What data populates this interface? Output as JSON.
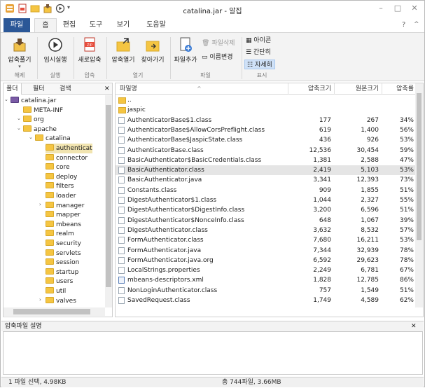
{
  "window": {
    "title": "catalina.jar - 알집",
    "controls": [
      "–",
      "□",
      "✕"
    ]
  },
  "quick_access": {
    "dropdown": "▾"
  },
  "tabs": {
    "file": "파일",
    "items": [
      "홈",
      "편집",
      "도구",
      "보기",
      "도움말"
    ],
    "help_icon": "?",
    "collapse_icon": "^"
  },
  "ribbon": {
    "extract_label": "압축풀기",
    "run_label": "임시실행",
    "new_label": "새로압축",
    "open_label": "압축열기",
    "find_label": "찾아가기",
    "add_label": "파일추가",
    "delete_label": "파일삭제",
    "rename_label": "이름변경",
    "view_icons": "아이콘",
    "view_simple": "간단히",
    "view_detail": "자세히",
    "groups": [
      "해제",
      "실행",
      "압축",
      "열기",
      "파일",
      "표시"
    ],
    "accent": "#2b5797"
  },
  "left": {
    "tabs": [
      "폴더",
      "필터",
      "검색"
    ],
    "close": "✕",
    "tree": [
      {
        "label": "catalina.jar",
        "level": 0,
        "toggle": "⌄",
        "icon": "jar"
      },
      {
        "label": "META-INF",
        "level": 1,
        "toggle": "",
        "icon": "folder"
      },
      {
        "label": "org",
        "level": 1,
        "toggle": "⌄",
        "icon": "folder"
      },
      {
        "label": "apache",
        "level": 2,
        "toggle": "⌄",
        "icon": "folder"
      },
      {
        "label": "catalina",
        "level": 3,
        "toggle": "⌄",
        "icon": "folder"
      },
      {
        "label": "authenticat",
        "level": 4,
        "toggle": "",
        "icon": "folder",
        "selected": true
      },
      {
        "label": "connector",
        "level": 4,
        "toggle": "",
        "icon": "folder"
      },
      {
        "label": "core",
        "level": 4,
        "toggle": "",
        "icon": "folder"
      },
      {
        "label": "deploy",
        "level": 4,
        "toggle": "",
        "icon": "folder"
      },
      {
        "label": "filters",
        "level": 4,
        "toggle": "",
        "icon": "folder"
      },
      {
        "label": "loader",
        "level": 4,
        "toggle": "",
        "icon": "folder"
      },
      {
        "label": "manager",
        "level": 4,
        "toggle": "›",
        "icon": "folder"
      },
      {
        "label": "mapper",
        "level": 4,
        "toggle": "",
        "icon": "folder"
      },
      {
        "label": "mbeans",
        "level": 4,
        "toggle": "",
        "icon": "folder"
      },
      {
        "label": "realm",
        "level": 4,
        "toggle": "",
        "icon": "folder"
      },
      {
        "label": "security",
        "level": 4,
        "toggle": "",
        "icon": "folder"
      },
      {
        "label": "servlets",
        "level": 4,
        "toggle": "",
        "icon": "folder"
      },
      {
        "label": "session",
        "level": 4,
        "toggle": "",
        "icon": "folder"
      },
      {
        "label": "startup",
        "level": 4,
        "toggle": "",
        "icon": "folder"
      },
      {
        "label": "users",
        "level": 4,
        "toggle": "",
        "icon": "folder"
      },
      {
        "label": "util",
        "level": 4,
        "toggle": "",
        "icon": "folder"
      },
      {
        "label": "valves",
        "level": 4,
        "toggle": "›",
        "icon": "folder"
      }
    ]
  },
  "list": {
    "columns": [
      "파일명",
      "압축크기",
      "원본크기",
      "압축률"
    ],
    "rows": [
      {
        "name": "..",
        "packed": "",
        "original": "",
        "ratio": "",
        "type": "folder"
      },
      {
        "name": "jaspic",
        "packed": "",
        "original": "",
        "ratio": "",
        "type": "folder"
      },
      {
        "name": "AuthenticatorBase$1.class",
        "packed": "177",
        "original": "267",
        "ratio": "34%",
        "type": "file"
      },
      {
        "name": "AuthenticatorBase$AllowCorsPreflight.class",
        "packed": "619",
        "original": "1,400",
        "ratio": "56%",
        "type": "file"
      },
      {
        "name": "AuthenticatorBase$JaspicState.class",
        "packed": "436",
        "original": "926",
        "ratio": "53%",
        "type": "file"
      },
      {
        "name": "AuthenticatorBase.class",
        "packed": "12,536",
        "original": "30,454",
        "ratio": "59%",
        "type": "file"
      },
      {
        "name": "BasicAuthenticator$BasicCredentials.class",
        "packed": "1,381",
        "original": "2,588",
        "ratio": "47%",
        "type": "file"
      },
      {
        "name": "BasicAuthenticator.class",
        "packed": "2,419",
        "original": "5,103",
        "ratio": "53%",
        "type": "file",
        "selected": true
      },
      {
        "name": "BasicAuthenticator.java",
        "packed": "3,341",
        "original": "12,393",
        "ratio": "73%",
        "type": "file"
      },
      {
        "name": "Constants.class",
        "packed": "909",
        "original": "1,855",
        "ratio": "51%",
        "type": "file"
      },
      {
        "name": "DigestAuthenticator$1.class",
        "packed": "1,044",
        "original": "2,327",
        "ratio": "55%",
        "type": "file"
      },
      {
        "name": "DigestAuthenticator$DigestInfo.class",
        "packed": "3,200",
        "original": "6,596",
        "ratio": "51%",
        "type": "file"
      },
      {
        "name": "DigestAuthenticator$NonceInfo.class",
        "packed": "648",
        "original": "1,067",
        "ratio": "39%",
        "type": "file"
      },
      {
        "name": "DigestAuthenticator.class",
        "packed": "3,632",
        "original": "8,532",
        "ratio": "57%",
        "type": "file"
      },
      {
        "name": "FormAuthenticator.class",
        "packed": "7,680",
        "original": "16,211",
        "ratio": "53%",
        "type": "file"
      },
      {
        "name": "FormAuthenticator.java",
        "packed": "7,344",
        "original": "32,939",
        "ratio": "78%",
        "type": "file"
      },
      {
        "name": "FormAuthenticator.java.org",
        "packed": "6,592",
        "original": "29,623",
        "ratio": "78%",
        "type": "file"
      },
      {
        "name": "LocalStrings.properties",
        "packed": "2,249",
        "original": "6,781",
        "ratio": "67%",
        "type": "file"
      },
      {
        "name": "mbeans-descriptors.xml",
        "packed": "1,828",
        "original": "12,785",
        "ratio": "86%",
        "type": "xml"
      },
      {
        "name": "NonLoginAuthenticator.class",
        "packed": "757",
        "original": "1,549",
        "ratio": "51%",
        "type": "file"
      },
      {
        "name": "SavedRequest.class",
        "packed": "1,749",
        "original": "4,589",
        "ratio": "62%",
        "type": "file"
      }
    ]
  },
  "description": {
    "title": "압축파일 설명",
    "close": "✕"
  },
  "status": {
    "left": "1 파일 선택, 4.98KB",
    "right": "총 744파일, 3.66MB"
  }
}
